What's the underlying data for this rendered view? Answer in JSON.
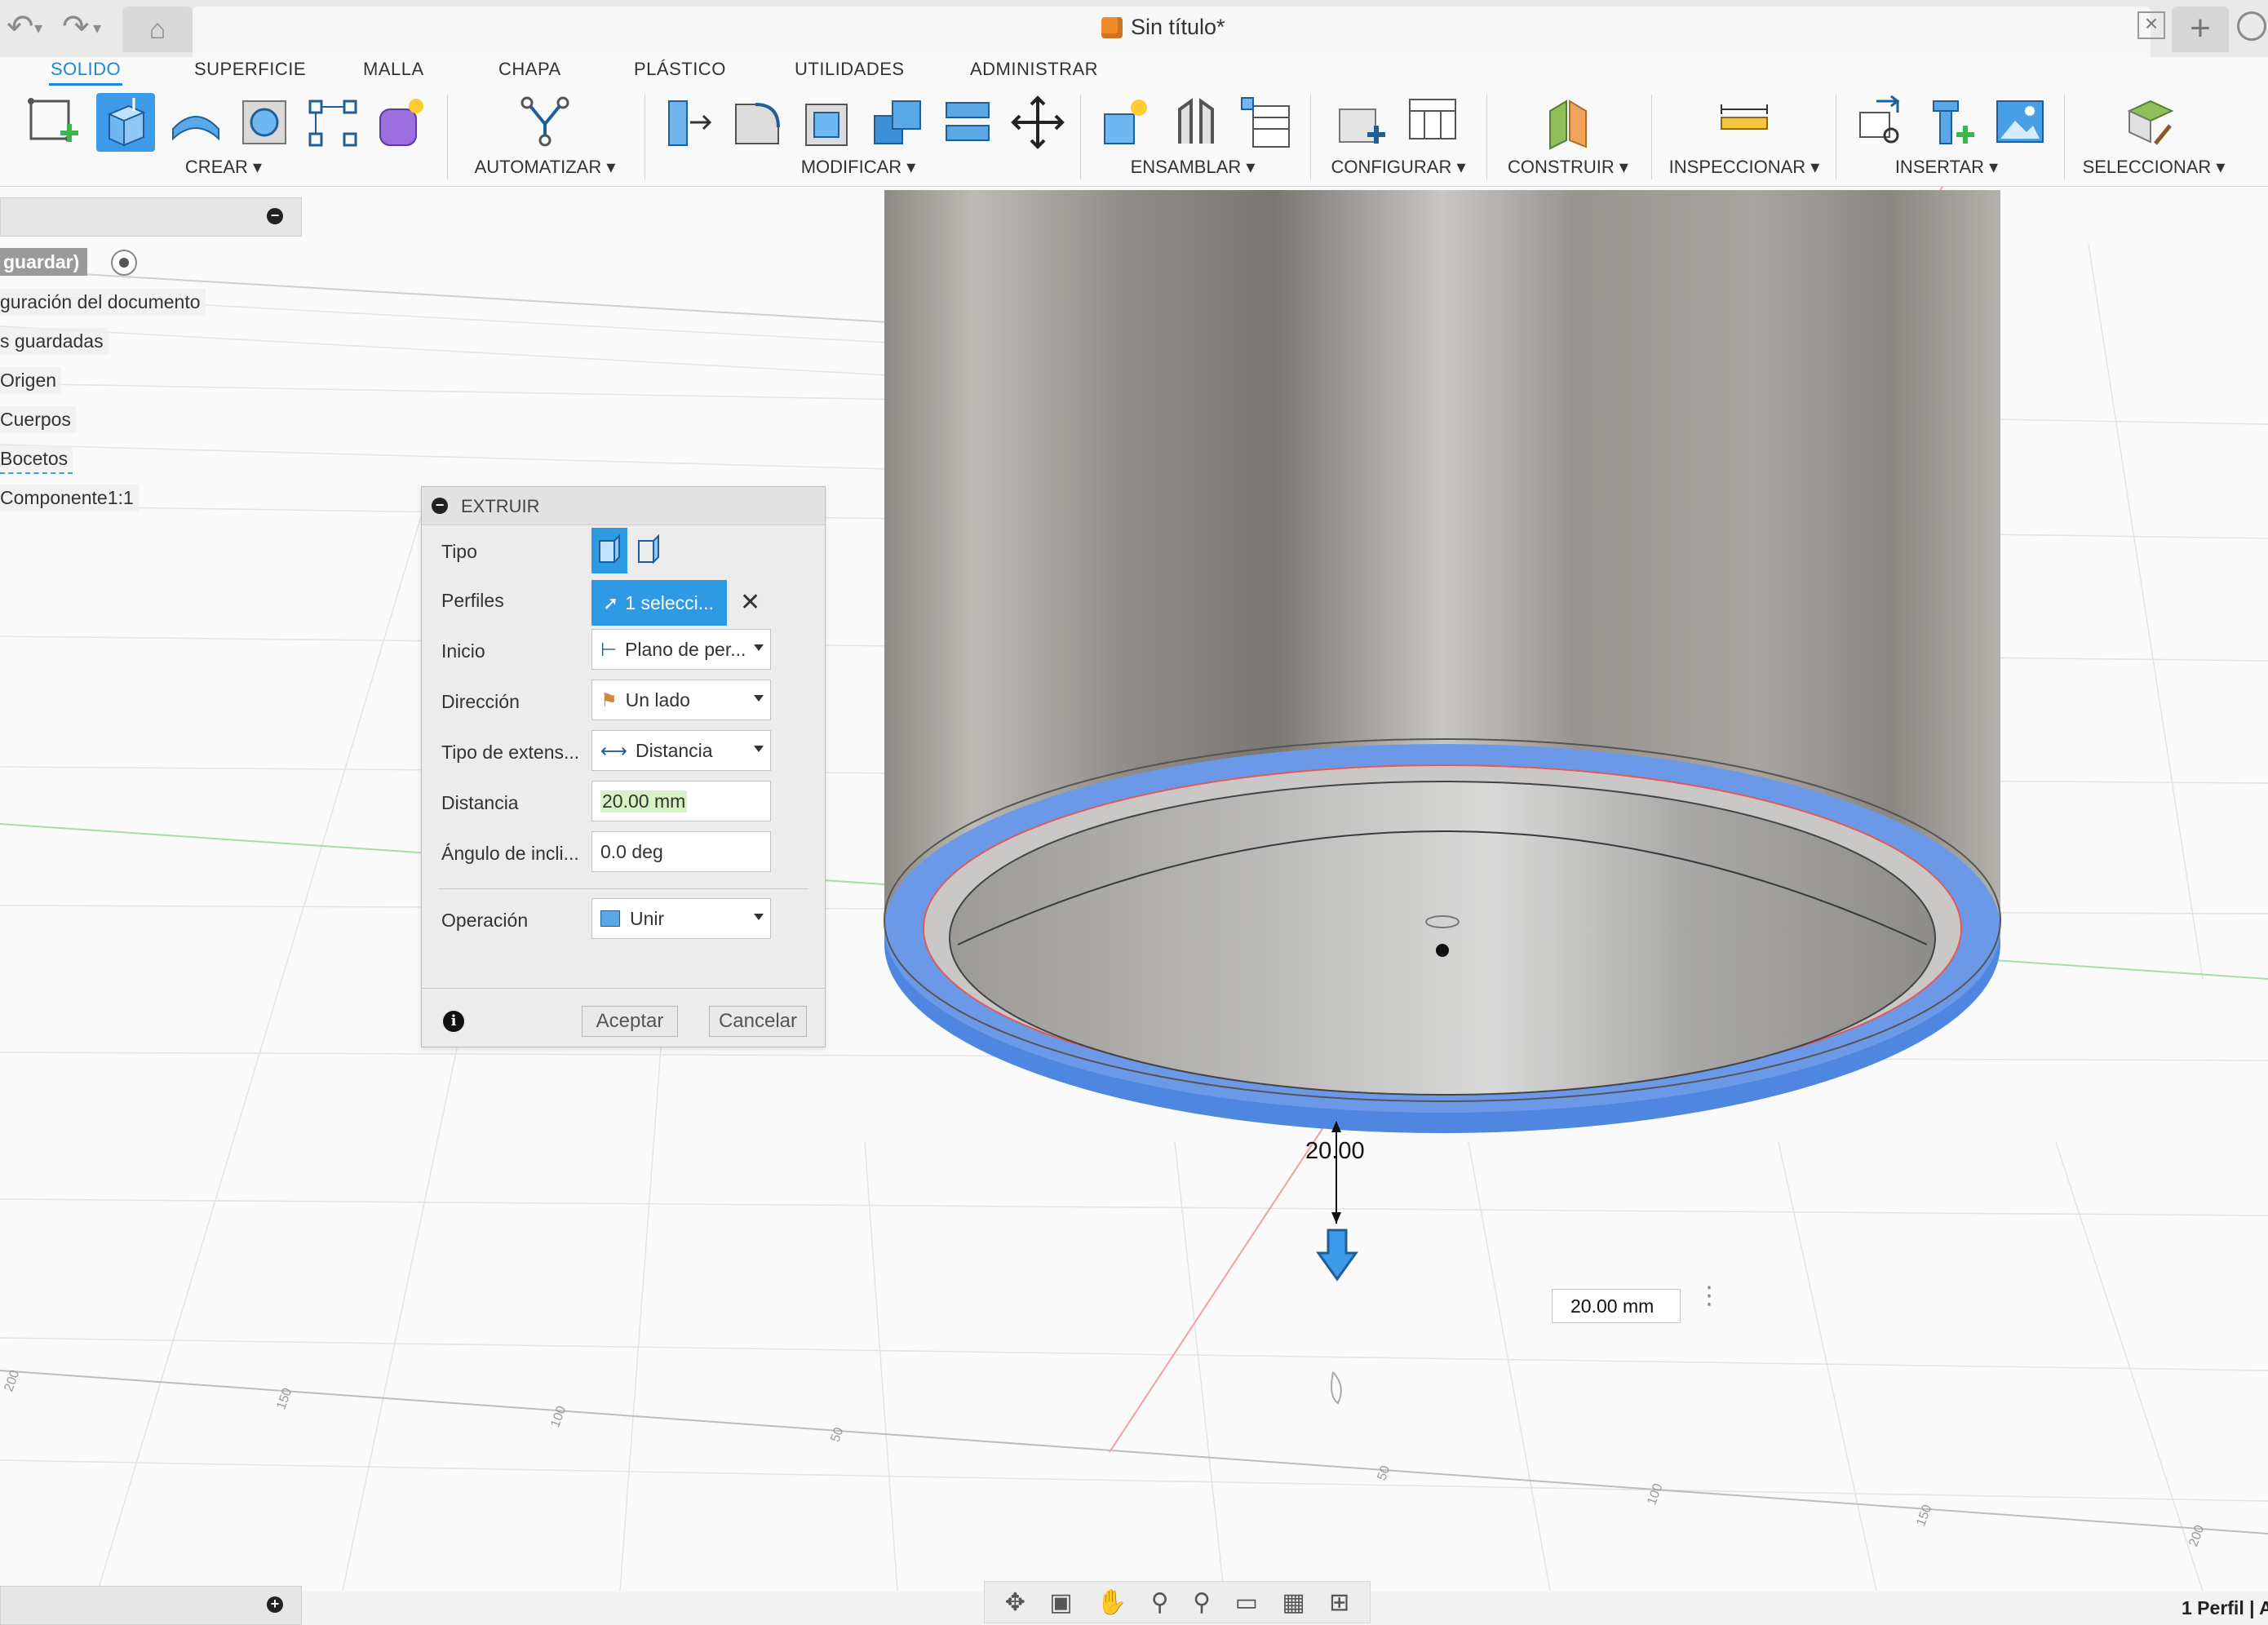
{
  "window": {
    "title": "Sin título*",
    "tab_close": "×",
    "tab_add": "+"
  },
  "ribbon": {
    "tabs": [
      {
        "label": "SOLIDO",
        "active": true
      },
      {
        "label": "SUPERFICIE"
      },
      {
        "label": "MALLA"
      },
      {
        "label": "CHAPA"
      },
      {
        "label": "PLÁSTICO"
      },
      {
        "label": "UTILIDADES"
      },
      {
        "label": "ADMINISTRAR"
      }
    ],
    "groups": [
      {
        "label": "CREAR ▾"
      },
      {
        "label": "AUTOMATIZAR ▾"
      },
      {
        "label": "MODIFICAR ▾"
      },
      {
        "label": "ENSAMBLAR ▾"
      },
      {
        "label": "CONFIGURAR ▾"
      },
      {
        "label": "CONSTRUIR ▾"
      },
      {
        "label": "INSPECCIONAR ▾"
      },
      {
        "label": "INSERTAR ▾"
      },
      {
        "label": "SELECCIONAR ▾"
      }
    ],
    "accent_color": "#1a8ad6"
  },
  "browser": {
    "unsaved_label": "guardar)",
    "items": [
      {
        "label": "guración del documento"
      },
      {
        "label": "s guardadas"
      },
      {
        "label": "Origen"
      },
      {
        "label": "Cuerpos"
      },
      {
        "label": "Bocetos"
      },
      {
        "label": "Componente1:1"
      }
    ]
  },
  "extrude": {
    "title": "EXTRUIR",
    "rows": {
      "tipo": {
        "label": "Tipo"
      },
      "perfiles": {
        "label": "Perfiles",
        "value": "1 selecci..."
      },
      "inicio": {
        "label": "Inicio",
        "value": "Plano de per..."
      },
      "direccion": {
        "label": "Dirección",
        "value": "Un lado"
      },
      "extension": {
        "label": "Tipo de extens...",
        "value": "Distancia"
      },
      "distancia": {
        "label": "Distancia",
        "value": "20.00 mm"
      },
      "angulo": {
        "label": "Ángulo de incli...",
        "value": "0.0 deg"
      },
      "operacion": {
        "label": "Operación",
        "value": "Unir"
      }
    },
    "accept_label": "Aceptar",
    "cancel_label": "Cancelar",
    "info": "i"
  },
  "viewport": {
    "dimension_label": "20.00",
    "floating_input": "20.00 mm",
    "ruler_labels": [
      "200",
      "150",
      "100",
      "50",
      "50",
      "100",
      "150",
      "200"
    ]
  },
  "status": {
    "selection": "1 Perfil | A"
  }
}
